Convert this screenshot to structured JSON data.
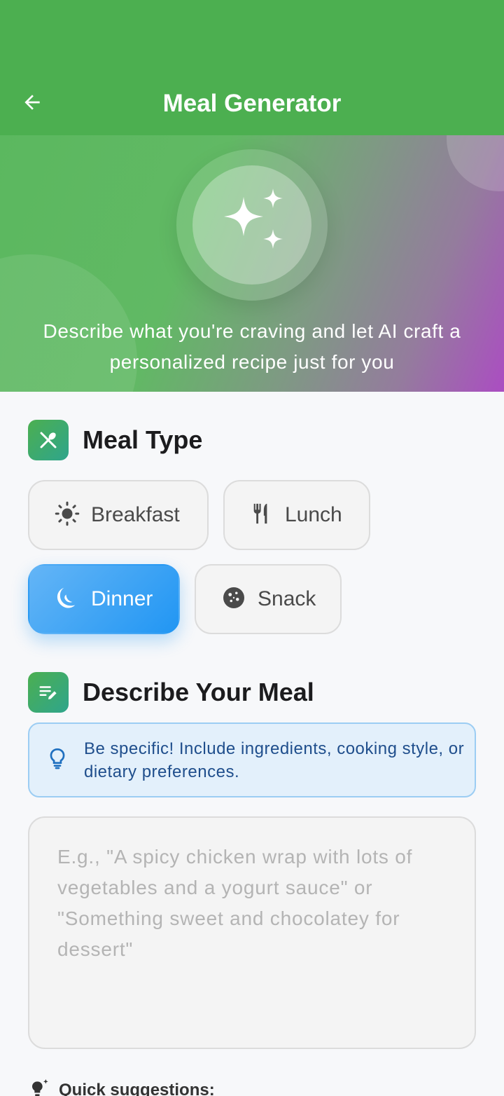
{
  "header": {
    "title": "Meal Generator",
    "back_icon": "arrow-back-icon"
  },
  "hero": {
    "icon": "sparkles-icon",
    "subtitle": "Describe what you're craving and let AI craft a personalized recipe just for you"
  },
  "meal_type": {
    "title": "Meal Type",
    "icon": "utensils-icon",
    "options": [
      {
        "label": "Breakfast",
        "icon": "sun-icon",
        "selected": false
      },
      {
        "label": "Lunch",
        "icon": "fork-knife-icon",
        "selected": false
      },
      {
        "label": "Dinner",
        "icon": "moon-icon",
        "selected": true
      },
      {
        "label": "Snack",
        "icon": "cookie-icon",
        "selected": false
      }
    ]
  },
  "describe": {
    "title": "Describe Your Meal",
    "icon": "edit-note-icon",
    "tip": "Be specific! Include ingredients, cooking style, or dietary preferences.",
    "tip_icon": "lightbulb-icon",
    "input_value": "",
    "placeholder": "E.g., \"A spicy chicken wrap with lots of vegetables and a yogurt sauce\" or \"Something sweet and chocolatey for dessert\""
  },
  "quick_suggestions": {
    "label": "Quick suggestions:",
    "icon": "lightbulb-sparkle-icon"
  },
  "colors": {
    "primary_green": "#4caf50",
    "selected_blue": "#2196f3",
    "hero_purple": "#ab4dc2",
    "tip_background": "#e3f0fb"
  }
}
